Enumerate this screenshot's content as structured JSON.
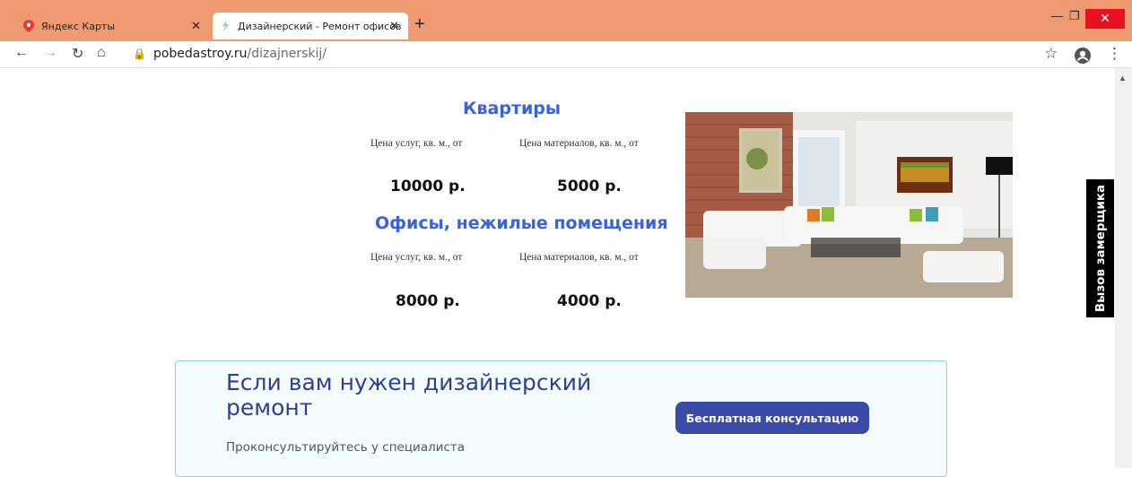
{
  "browser": {
    "tabs": [
      {
        "title": "Яндекс Карты",
        "active": false
      },
      {
        "title": "Дизайнерский - Ремонт офисов",
        "active": true
      }
    ],
    "url_domain": "pobedastroy.ru",
    "url_path": "/dizajnerskij/"
  },
  "page": {
    "apartments": {
      "heading": "Квартиры",
      "services_label": "Цена услуг, кв. м., от",
      "materials_label": "Цена материалов, кв. м., от",
      "services_price": "10000 р.",
      "materials_price": "5000 р."
    },
    "offices": {
      "heading": "Офисы, нежилые помещения",
      "services_label": "Цена услуг, кв. м., от",
      "materials_label": "Цена материалов, кв. м., от",
      "services_price": "8000 р.",
      "materials_price": "4000 р."
    },
    "side_button": "Вызов замерщика",
    "consult": {
      "title": "Если вам нужен дизайнерский ремонт",
      "subtitle": "Проконсультируйтесь у специалиста",
      "button": "Бесплатная консультацию"
    }
  },
  "colors": {
    "tabbar": "#ef9a70",
    "heading": "#3a63d8",
    "cta": "#3a4ba8",
    "card_title": "#2e3f8e"
  }
}
